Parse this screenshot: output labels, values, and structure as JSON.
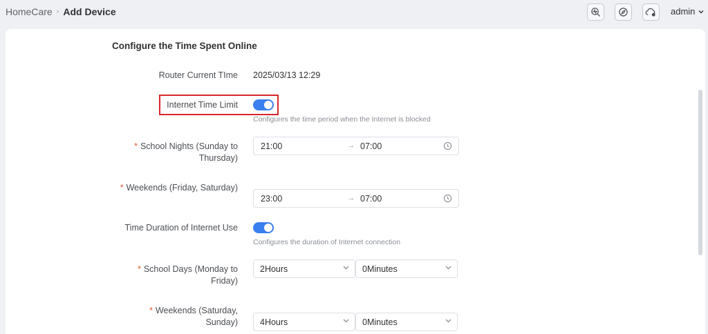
{
  "breadcrumb": {
    "parent": "HomeCare",
    "separator": "›",
    "current": "Add Device"
  },
  "header": {
    "icons": [
      "diagnostics-icon",
      "compass-icon",
      "cloud-icon"
    ],
    "user": "admin"
  },
  "section": {
    "title": "Configure the Time Spent Online"
  },
  "router_time": {
    "label": "Router Current TIme",
    "value": "2025/03/13 12:29"
  },
  "internet_time_limit": {
    "label": "Internet Time Limit",
    "enabled": true,
    "hint": "Configures the time period when the Internet is blocked"
  },
  "school_nights": {
    "required": "*",
    "label_line1": "School Nights (Sunday to",
    "label_line2": "Thursday)",
    "start": "21:00",
    "arrow": "→",
    "end": "07:00"
  },
  "weekends_block": {
    "required": "*",
    "label": "Weekends (Friday, Saturday)",
    "start": "23:00",
    "arrow": "→",
    "end": "07:00"
  },
  "duration": {
    "label": "Time Duration of Internet Use",
    "enabled": true,
    "hint": "Configures the duration of Internet connection"
  },
  "school_days": {
    "required": "*",
    "label_line1": "School Days (Monday to",
    "label_line2": "Friday)",
    "hours": "2Hours",
    "minutes": "0Minutes"
  },
  "weekends_duration": {
    "required": "*",
    "label_line1": "Weekends (Saturday,",
    "label_line2": "Sunday)",
    "hours": "4Hours",
    "minutes": "0Minutes"
  },
  "colors": {
    "accent": "#3a7ff0",
    "required": "#e4562f",
    "highlight": "#d8262b"
  }
}
